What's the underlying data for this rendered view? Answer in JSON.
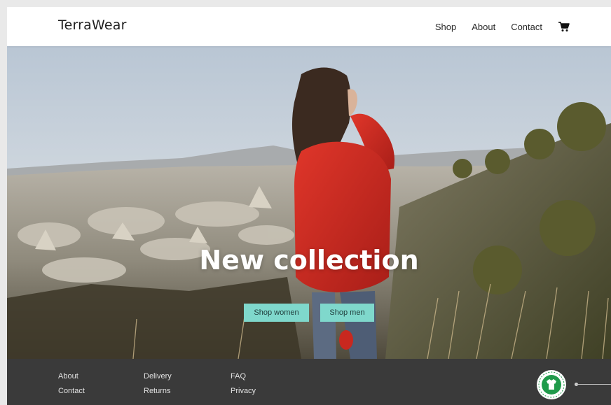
{
  "brand": {
    "name": "TerraWear"
  },
  "nav": {
    "items": [
      {
        "label": "Shop"
      },
      {
        "label": "About"
      },
      {
        "label": "Contact"
      }
    ],
    "cart_icon": "shopping-cart-icon"
  },
  "hero": {
    "title": "New collection",
    "buttons": {
      "women": "Shop women",
      "men": "Shop men"
    }
  },
  "footer": {
    "col1": [
      "About",
      "Contact"
    ],
    "col2": [
      "Delivery",
      "Returns"
    ],
    "col3": [
      "FAQ",
      "Privacy"
    ],
    "badge_icon": "organic-textile-badge-icon"
  },
  "colors": {
    "accent": "#7fd8cc",
    "jacket": "#c8281f",
    "footer_bg": "#3a3a3a",
    "header_bg": "#ffffff"
  }
}
